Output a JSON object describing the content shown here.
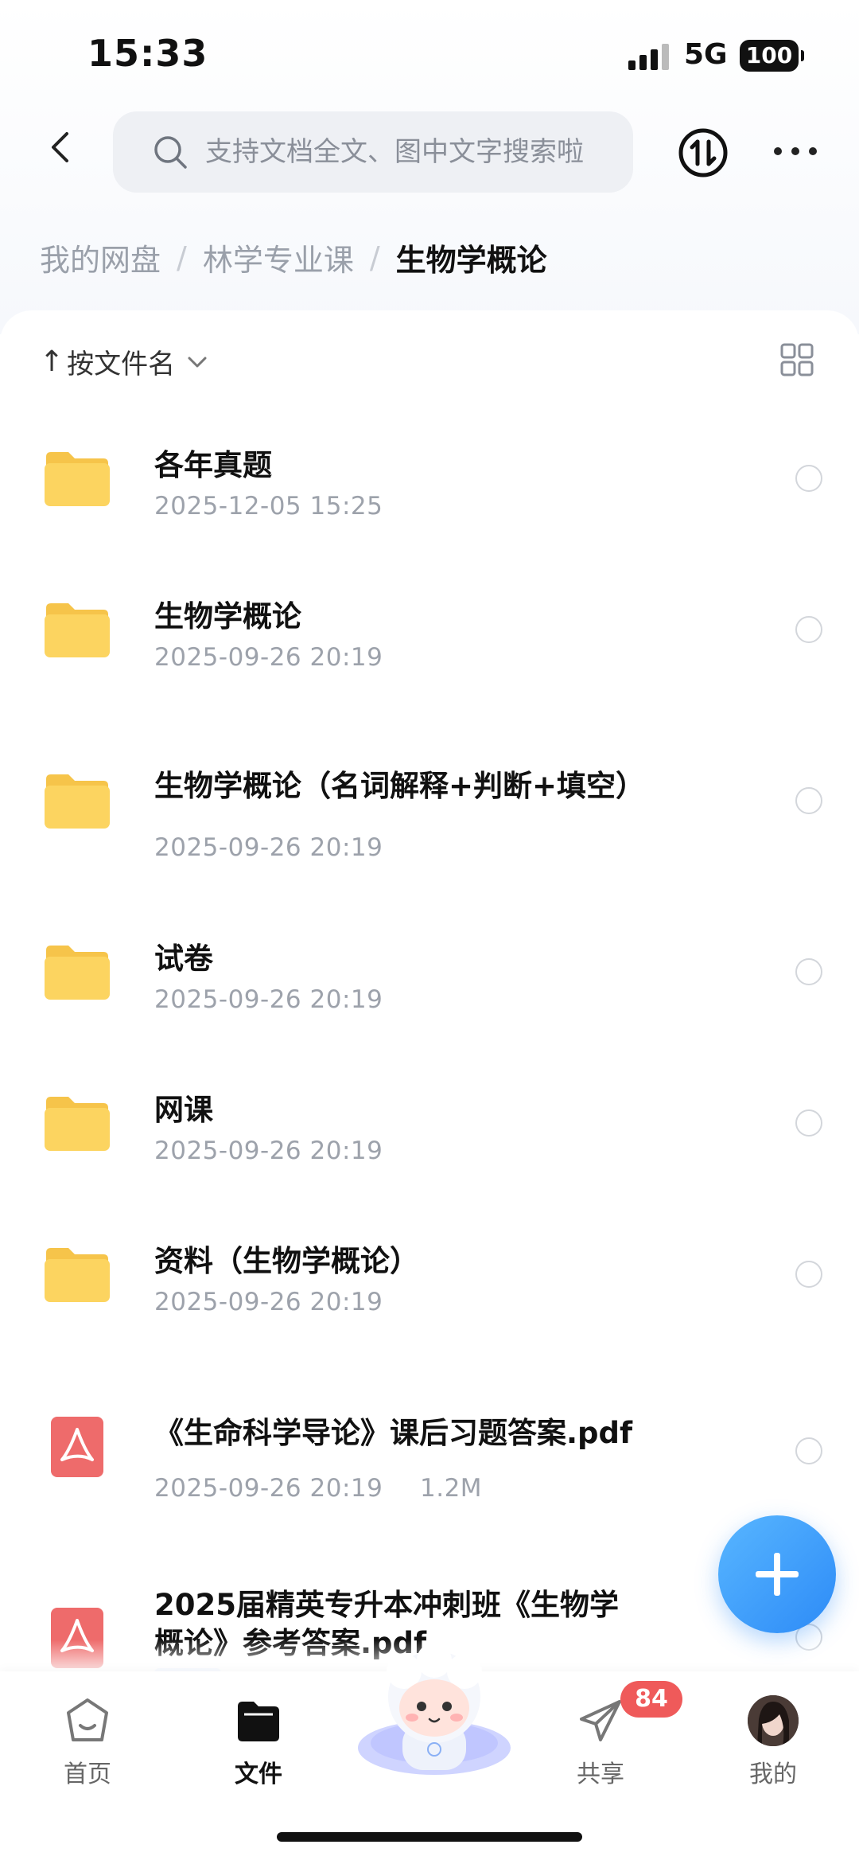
{
  "status_bar": {
    "time": "15:33",
    "network": "5G",
    "battery": "100"
  },
  "header": {
    "search_placeholder": "支持文档全文、图中文字搜索啦"
  },
  "breadcrumb": {
    "items": [
      "我的网盘",
      "林学专业课"
    ],
    "current": "生物学概论",
    "separator": "/"
  },
  "sort": {
    "arrow": "↑",
    "label": "按文件名"
  },
  "files": [
    {
      "type": "folder",
      "name": "各年真题",
      "date": "2025-12-05 15:25",
      "size": ""
    },
    {
      "type": "folder",
      "name": "生物学概论",
      "date": "2025-09-26 20:19",
      "size": ""
    },
    {
      "type": "folder",
      "name": "生物学概论（名词解释+判断+填空）",
      "date": "2025-09-26 20:19",
      "size": ""
    },
    {
      "type": "folder",
      "name": "试卷",
      "date": "2025-09-26 20:19",
      "size": ""
    },
    {
      "type": "folder",
      "name": "网课",
      "date": "2025-09-26 20:19",
      "size": ""
    },
    {
      "type": "folder",
      "name": "资料（生物学概论）",
      "date": "2025-09-26 20:19",
      "size": ""
    },
    {
      "type": "pdf",
      "name": "《生命科学导论》课后习题答案.pdf",
      "date": "2025-09-26 20:19",
      "size": "1.2M"
    },
    {
      "type": "pdf",
      "name_line1": "2025届精英专升本冲刺班《生物学",
      "name_line2": "概论》参考答案.pdf"
    }
  ],
  "tabbar": {
    "home": "首页",
    "files": "文件",
    "share": "共享",
    "share_badge": "84",
    "me": "我的"
  },
  "colors": {
    "accent": "#2d8bf7",
    "badge": "#ef5a5a",
    "folder": "#fcd15f",
    "pdf": "#ee6b6b"
  }
}
